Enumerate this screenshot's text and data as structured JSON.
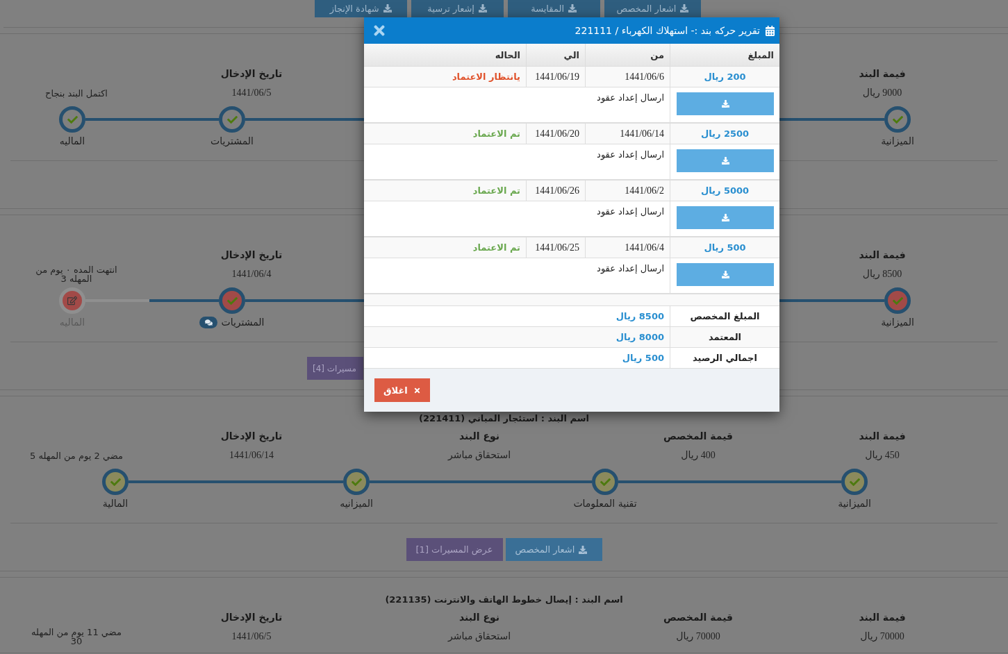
{
  "top_buttons": [
    {
      "label": "اشعار المخصص"
    },
    {
      "label": "المقايسة"
    },
    {
      "label": "إشعار ترسية"
    },
    {
      "label": "شهادة الإنجاز"
    }
  ],
  "sections": [
    {
      "fields": {
        "item_value": {
          "label": "فيمة البند",
          "value": "9000 ريال"
        },
        "entry_date": {
          "label": "تاريخ الإدخال",
          "value": "1441/06/5"
        },
        "deadline": {
          "value": "اكتمل البند بنجاح"
        }
      },
      "steps": [
        {
          "label": "الميزانية",
          "kind": "done",
          "comments": false
        },
        {
          "label": "المشتريات",
          "kind": "done",
          "comments": false
        },
        {
          "label": "الماليه",
          "kind": "done",
          "comments": false
        }
      ]
    },
    {
      "fields": {
        "item_value": {
          "label": "فيمة البند",
          "value": "8500 ريال"
        },
        "entry_date": {
          "label": "تاريخ الإدخال",
          "value": "1441/06/4"
        },
        "deadline": {
          "value": "انتهت المده ٠ يوم من المهله 3"
        }
      },
      "steps": [
        {
          "label": "الميزانية",
          "kind": "late",
          "comments": false
        },
        {
          "label": "المشتريات",
          "kind": "late",
          "comments": true
        },
        {
          "label": "الماليه",
          "kind": "overdue",
          "comments": false
        }
      ],
      "buttons": [
        {
          "label": "مسيرات [4]",
          "kind": "routes"
        }
      ]
    },
    {
      "title": "اسم البند : استئجار المباني (221411)",
      "fields": {
        "item_value": {
          "label": "فيمة البند",
          "value": "450 ريال"
        },
        "allocated": {
          "label": "قيمة المخصص",
          "value": "400 ريال"
        },
        "type": {
          "label": "نوع البند",
          "value": "استحقاق مباشر"
        },
        "entry_date": {
          "label": "تاريخ الإدخال",
          "value": "1441/06/14"
        },
        "deadline": {
          "value": "مضي 2 يوم من المهله 5"
        }
      },
      "steps": [
        {
          "label": "الميزانية",
          "kind": "checked",
          "comments": false
        },
        {
          "label": "تقنية المعلومات",
          "kind": "checked",
          "comments": false
        },
        {
          "label": "الميزانيه",
          "kind": "checked",
          "comments": false
        },
        {
          "label": "المالية",
          "kind": "checked",
          "comments": false
        }
      ],
      "buttons": [
        {
          "label": "اشعار المخصص",
          "kind": "notice"
        },
        {
          "label": "عرض المسيرات [1]",
          "kind": "routes"
        }
      ]
    },
    {
      "title": "اسم البند : إيصال خطوط الهاتف والانترنت (221135)",
      "fields": {
        "item_value": {
          "label": "فيمة البند",
          "value": "70000 ريال"
        },
        "allocated": {
          "label": "قيمة المخصص",
          "value": "70000 ريال"
        },
        "type": {
          "label": "نوع البند",
          "value": "استحقاق مباشر"
        },
        "entry_date": {
          "label": "تاريخ الإدخال",
          "value": "1441/06/5"
        },
        "deadline": {
          "value": "مضي 11 يوم من المهله 30"
        }
      }
    }
  ],
  "modal": {
    "title": "تقرير حركه بند :- استهلاك الكهرباء / 221111",
    "columns": [
      "المبلغ",
      "من",
      "الي",
      "الحاله"
    ],
    "entries": [
      {
        "amount": "200 ريال",
        "from": "1441/06/6",
        "to": "1441/06/19",
        "status": {
          "text": "يانتظار الاعتماد",
          "kind": "pending"
        },
        "note": "ارسال إعداد عقود"
      },
      {
        "amount": "2500 ريال",
        "from": "1441/06/14",
        "to": "1441/06/20",
        "status": {
          "text": "تم الاعتماد",
          "kind": "approved"
        },
        "note": "ارسال إعداد عقود"
      },
      {
        "amount": "5000 ريال",
        "from": "1441/06/2",
        "to": "1441/06/26",
        "status": {
          "text": "تم الاعتماد",
          "kind": "approved"
        },
        "note": "ارسال إعداد عقود"
      },
      {
        "amount": "500 ريال",
        "from": "1441/06/4",
        "to": "1441/06/25",
        "status": {
          "text": "تم الاعتماد",
          "kind": "approved"
        },
        "note": "ارسال إعداد عقود"
      }
    ],
    "summary": [
      {
        "label": "المبلغ المخصص",
        "value": "8500 ريال"
      },
      {
        "label": "المعتمد",
        "value": "8000 ريال"
      },
      {
        "label": "اجمالي الرصيد",
        "value": "500 ريال"
      }
    ],
    "close_label": "اغلاق"
  }
}
